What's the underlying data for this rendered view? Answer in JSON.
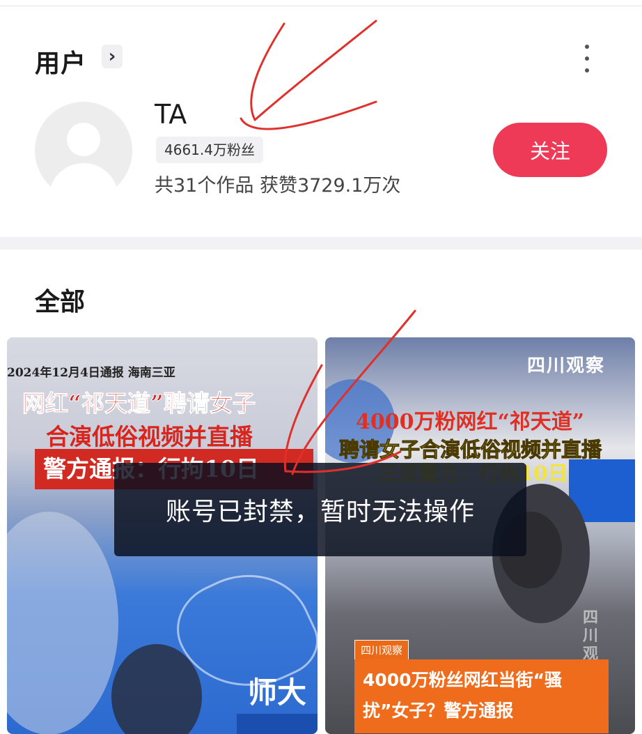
{
  "user_section": {
    "title": "用户",
    "chevron": "›",
    "more_icon": "more-vertical-icon"
  },
  "profile": {
    "name": "TA",
    "fans": "4661.4万粉丝",
    "stats": "共31个作品 获赞3729.1万次",
    "follow_label": "关注"
  },
  "works_section": {
    "title": "全部"
  },
  "videos": [
    {
      "date_line": "2024年12月4日通报 海南三亚",
      "headline_1": "网红“祁天道”聘请女子",
      "headline_2": "合演低俗视频并直播",
      "banner": "警方通报：行拘10日",
      "logo_text": "师大"
    },
    {
      "brand": "四川观察",
      "headline_1": "4000万粉网红“祁天道”",
      "headline_2": "聘请女子合演低俗视频并直播",
      "headline_3": "三亚警方：行拘10日",
      "tag": "四川观察",
      "caption": "4000万粉丝网红当街“骚扰”女子？警方通报",
      "watermark": "四川观察"
    }
  ],
  "toast": {
    "message": "账号已封禁，暂时无法操作"
  },
  "colors": {
    "follow_button": "#ee3a57",
    "annotation": "#e0302b",
    "toast_bg": "#0a0f1e"
  }
}
